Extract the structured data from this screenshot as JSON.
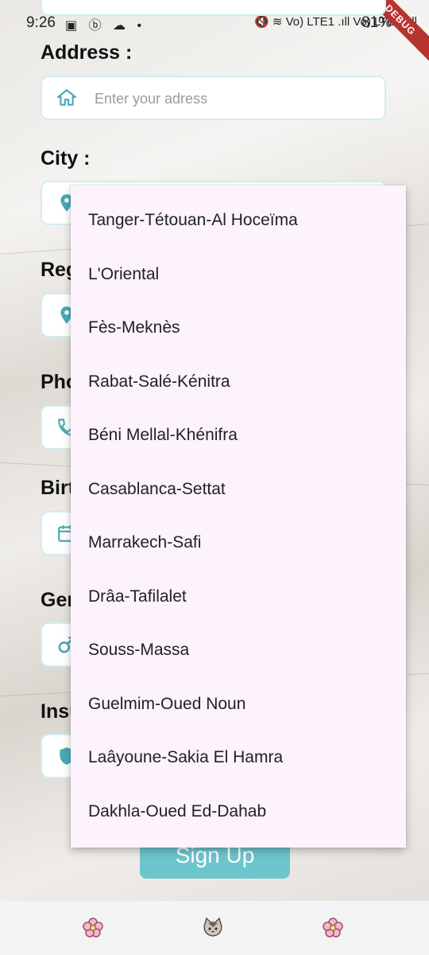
{
  "status_bar": {
    "time": "9:26",
    "left_icons": "▣ ⓑ ☁ •",
    "right_icons": "🔇 ≋ Vo) LTE1 .ıll Vo) LTE2 .ıll",
    "battery": "81%",
    "debug_banner": "DEBUG"
  },
  "form": {
    "address_label": "Address :",
    "address_placeholder": "Enter your adress",
    "city_label": "City :",
    "region_label_partial": "Reg",
    "phone_label_partial": "Pho",
    "birth_label_partial": "Birt",
    "gender_label_partial": "Ger",
    "insurance_label_partial": "Insu"
  },
  "region_menu": {
    "options": [
      "Tanger-Tétouan-Al Hoceïma",
      "L'Oriental",
      "Fès-Meknès",
      "Rabat-Salé-Kénitra",
      "Béni Mellal-Khénifra",
      "Casablanca-Settat",
      "Marrakech-Safi",
      "Drâa-Tafilalet",
      "Souss-Massa",
      "Guelmim-Oued Noun",
      "Laâyoune-Sakia El Hamra",
      "Dakhla-Oued Ed-Dahab"
    ]
  },
  "signup_button": "Sign Up",
  "colors": {
    "accent": "#4aa9b5",
    "button": "#6dc5cc",
    "menu_bg": "#fcf3fc",
    "field_border": "#cfeef0"
  },
  "bottom_nav": {
    "left_icon": "flower-icon",
    "center_icon": "cat-icon",
    "right_icon": "flower-icon"
  }
}
